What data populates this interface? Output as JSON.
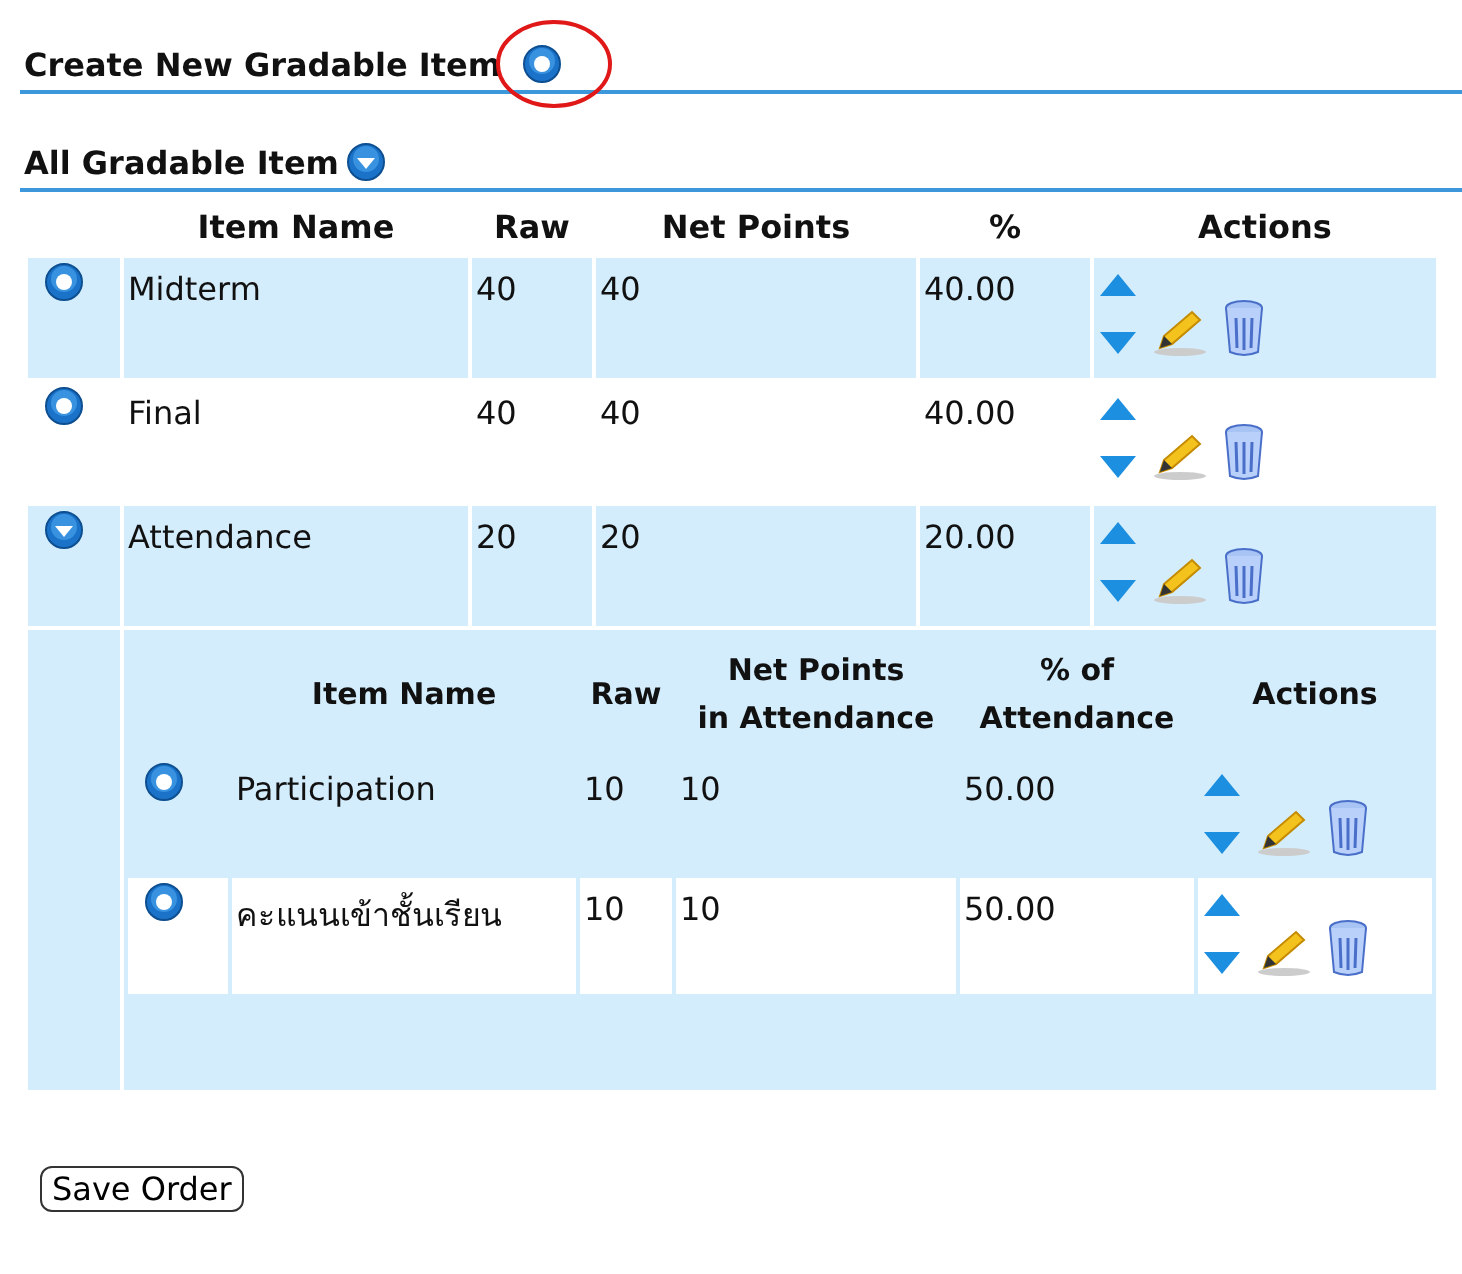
{
  "create_section": {
    "title": "Create New Gradable Item",
    "expanded": false,
    "highlighted": true
  },
  "list_section": {
    "title": "All Gradable Item",
    "expanded": true
  },
  "table": {
    "columns": [
      "Item Name",
      "Raw",
      "Net Points",
      "%",
      "Actions"
    ],
    "rows": [
      {
        "name": "Midterm",
        "raw": "40",
        "net_points": "40",
        "percent": "40.00",
        "expanded": false
      },
      {
        "name": "Final",
        "raw": "40",
        "net_points": "40",
        "percent": "40.00",
        "expanded": false
      },
      {
        "name": "Attendance",
        "raw": "20",
        "net_points": "20",
        "percent": "20.00",
        "expanded": true,
        "sub_table": {
          "columns": [
            {
              "line1": "Item Name"
            },
            {
              "line1": "Raw"
            },
            {
              "line1": "Net Points",
              "line2": "in Attendance"
            },
            {
              "line1": "% of",
              "line2": "Attendance"
            },
            {
              "line1": "Actions"
            }
          ],
          "rows": [
            {
              "name": "Participation",
              "raw": "10",
              "net_points": "10",
              "percent": "50.00",
              "expanded": false
            },
            {
              "name": "คะแนนเข้าชั้นเรียน",
              "raw": "10",
              "net_points": "10",
              "percent": "50.00",
              "expanded": false
            }
          ]
        }
      }
    ]
  },
  "buttons": [
    "Save Order"
  ]
}
